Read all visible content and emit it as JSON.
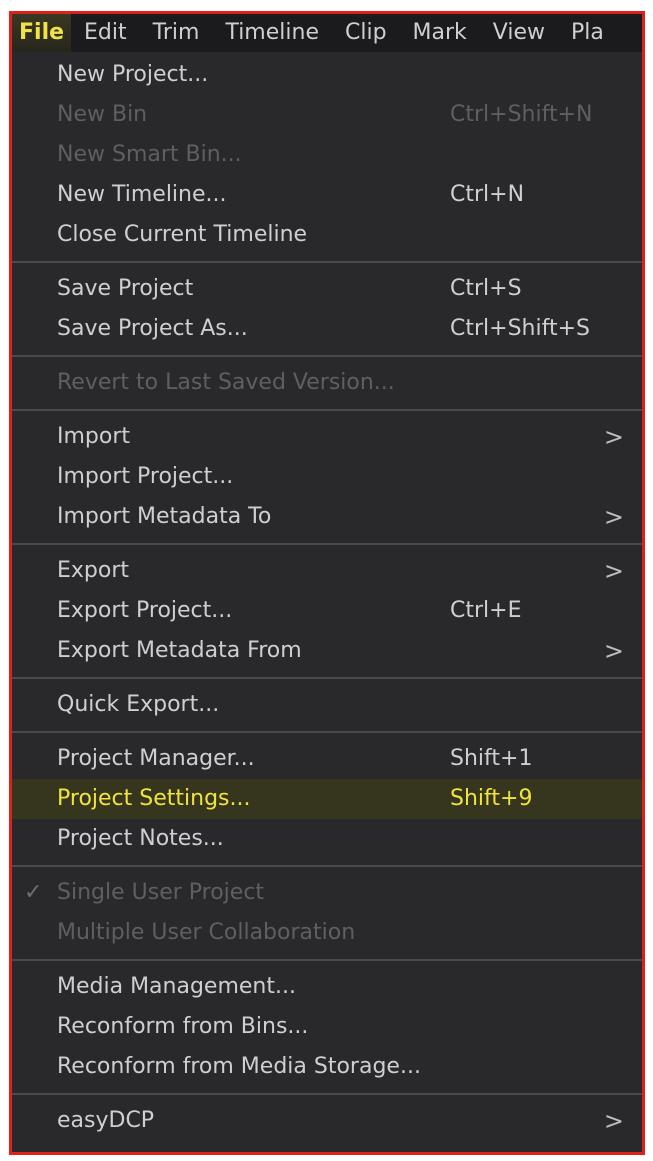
{
  "menubar": {
    "items": [
      "File",
      "Edit",
      "Trim",
      "Timeline",
      "Clip",
      "Mark",
      "View",
      "Pla"
    ],
    "active": "File"
  },
  "menu": {
    "new_project": "New Project...",
    "new_bin": "New Bin",
    "new_bin_shortcut": "Ctrl+Shift+N",
    "new_smart_bin": "New Smart Bin...",
    "new_timeline": "New Timeline...",
    "new_timeline_shortcut": "Ctrl+N",
    "close_current_timeline": "Close Current Timeline",
    "save_project": "Save Project",
    "save_project_shortcut": "Ctrl+S",
    "save_project_as": "Save Project As...",
    "save_project_as_shortcut": "Ctrl+Shift+S",
    "revert": "Revert to Last Saved Version...",
    "import": "Import",
    "import_project": "Import Project...",
    "import_metadata_to": "Import Metadata To",
    "export": "Export",
    "export_project": "Export Project...",
    "export_project_shortcut": "Ctrl+E",
    "export_metadata_from": "Export Metadata From",
    "quick_export": "Quick Export...",
    "project_manager": "Project Manager...",
    "project_manager_shortcut": "Shift+1",
    "project_settings": "Project Settings...",
    "project_settings_shortcut": "Shift+9",
    "project_notes": "Project Notes...",
    "single_user_project": "Single User Project",
    "multiple_user_collaboration": "Multiple User Collaboration",
    "media_management": "Media Management...",
    "reconform_from_bins": "Reconform from Bins...",
    "reconform_from_media_storage": "Reconform from Media Storage...",
    "easydcp": "easyDCP",
    "arrow_glyph": ">",
    "check_glyph": "✓"
  },
  "colors": {
    "frame_border": "#e0201b",
    "menu_bg": "#29292c",
    "menubar_bg": "#1b1b1d",
    "highlight_text": "#f0e43c",
    "disabled_text": "#5f5f62"
  }
}
